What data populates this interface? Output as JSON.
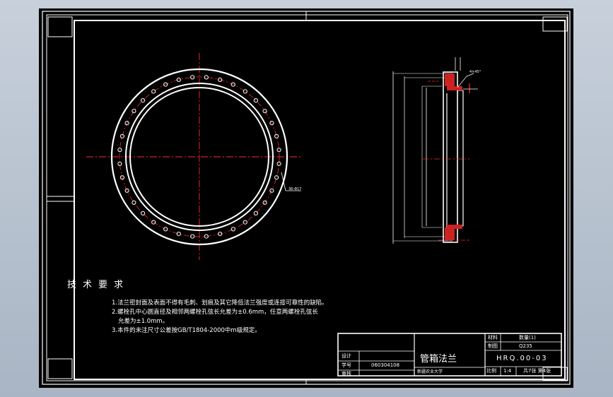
{
  "technical_requirements": {
    "title": "技术要求",
    "items": [
      "1.法兰密封面及表面不得有毛刺、划痕及其它降低法兰强度或连接可靠性的缺陷。",
      "2.螺栓孔中心圆直径及相邻两螺栓孔弦长允差为±0.6mm，任意两螺栓孔弦长",
      "允差为±1.0mm。",
      "3.本件的未注尺寸公差按GB/T1804-2000中m级规定。"
    ]
  },
  "annotations": {
    "hole_callout": "36-Φ17",
    "chamfer": "4×45°"
  },
  "title_block": {
    "part_name": "管箱法兰",
    "drawing_number": "HRQ.00-03",
    "material_label": "材料",
    "material": "Q235",
    "scale_label": "比例",
    "scale": "1:4",
    "quantity_label": "数量(1)",
    "drawing_label": "制图",
    "designer_label": "设计",
    "student_label": "学号",
    "student_id": "060304108",
    "checker_label": "审核",
    "school": "新疆农业大学",
    "sheet_info": "共7张 第4张"
  },
  "colors": {
    "background": "#000000",
    "lines": "#ffffff",
    "centerline": "#ff2a2a",
    "hatch": "#cc2222"
  }
}
